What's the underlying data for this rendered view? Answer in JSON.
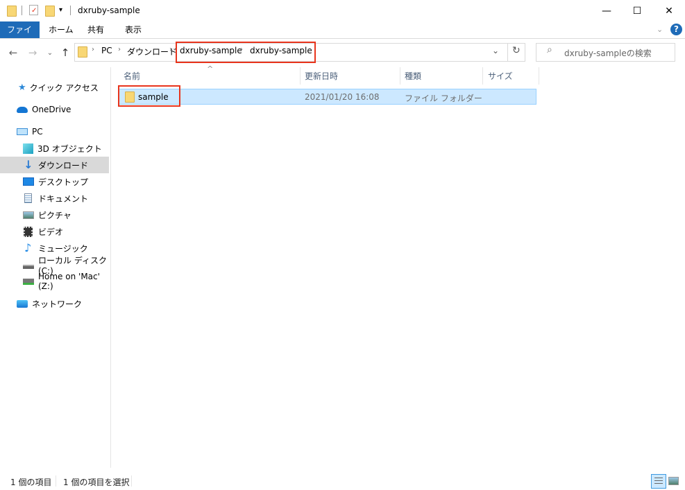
{
  "window": {
    "title": "dxruby-sample",
    "controls": {
      "minimize": "—",
      "maximize": "☐",
      "close": "✕"
    }
  },
  "ribbon": {
    "tabs": [
      {
        "label": "ファイル",
        "active": true
      },
      {
        "label": "ホーム",
        "active": false
      },
      {
        "label": "共有",
        "active": false
      },
      {
        "label": "表示",
        "active": false
      }
    ],
    "expand_icon": "⌄",
    "help_icon": "?"
  },
  "navigation": {
    "back": "←",
    "forward": "→",
    "recent": "⌄",
    "up": "↑",
    "breadcrumb": [
      "PC",
      "ダウンロード",
      "dxruby-sample",
      "dxruby-sample"
    ],
    "separator": "›",
    "dropdown": "⌄",
    "refresh": "↻"
  },
  "search": {
    "placeholder": "dxruby-sampleの検索",
    "icon": "⌕"
  },
  "sidebar": {
    "items": [
      {
        "label": "クイック アクセス",
        "icon": "star-icon"
      },
      {
        "label": "OneDrive",
        "icon": "cloud-icon"
      },
      {
        "label": "PC",
        "icon": "computer-icon"
      },
      {
        "label": "3D オブジェクト",
        "icon": "cube-icon"
      },
      {
        "label": "ダウンロード",
        "icon": "download-icon",
        "selected": true
      },
      {
        "label": "デスクトップ",
        "icon": "desktop-icon"
      },
      {
        "label": "ドキュメント",
        "icon": "document-icon"
      },
      {
        "label": "ピクチャ",
        "icon": "picture-icon"
      },
      {
        "label": "ビデオ",
        "icon": "video-icon"
      },
      {
        "label": "ミュージック",
        "icon": "music-icon"
      },
      {
        "label": "ローカル ディスク (C:)",
        "icon": "drive-icon"
      },
      {
        "label": "Home on 'Mac' (Z:)",
        "icon": "network-drive-icon"
      },
      {
        "label": "ネットワーク",
        "icon": "network-icon"
      }
    ]
  },
  "file_list": {
    "sort_indicator": "^",
    "columns": [
      "名前",
      "更新日時",
      "種類",
      "サイズ"
    ],
    "rows": [
      {
        "name": "sample",
        "modified": "2021/01/20 16:08",
        "type": "ファイル フォルダー",
        "size": ""
      }
    ]
  },
  "status_bar": {
    "item_count": "1 個の項目",
    "selected_count": "1 個の項目を選択"
  },
  "colors": {
    "accent": "#1e6bb8",
    "highlight_box": "#e8341c",
    "selection": "#cce8ff",
    "folder": "#f8d775"
  }
}
